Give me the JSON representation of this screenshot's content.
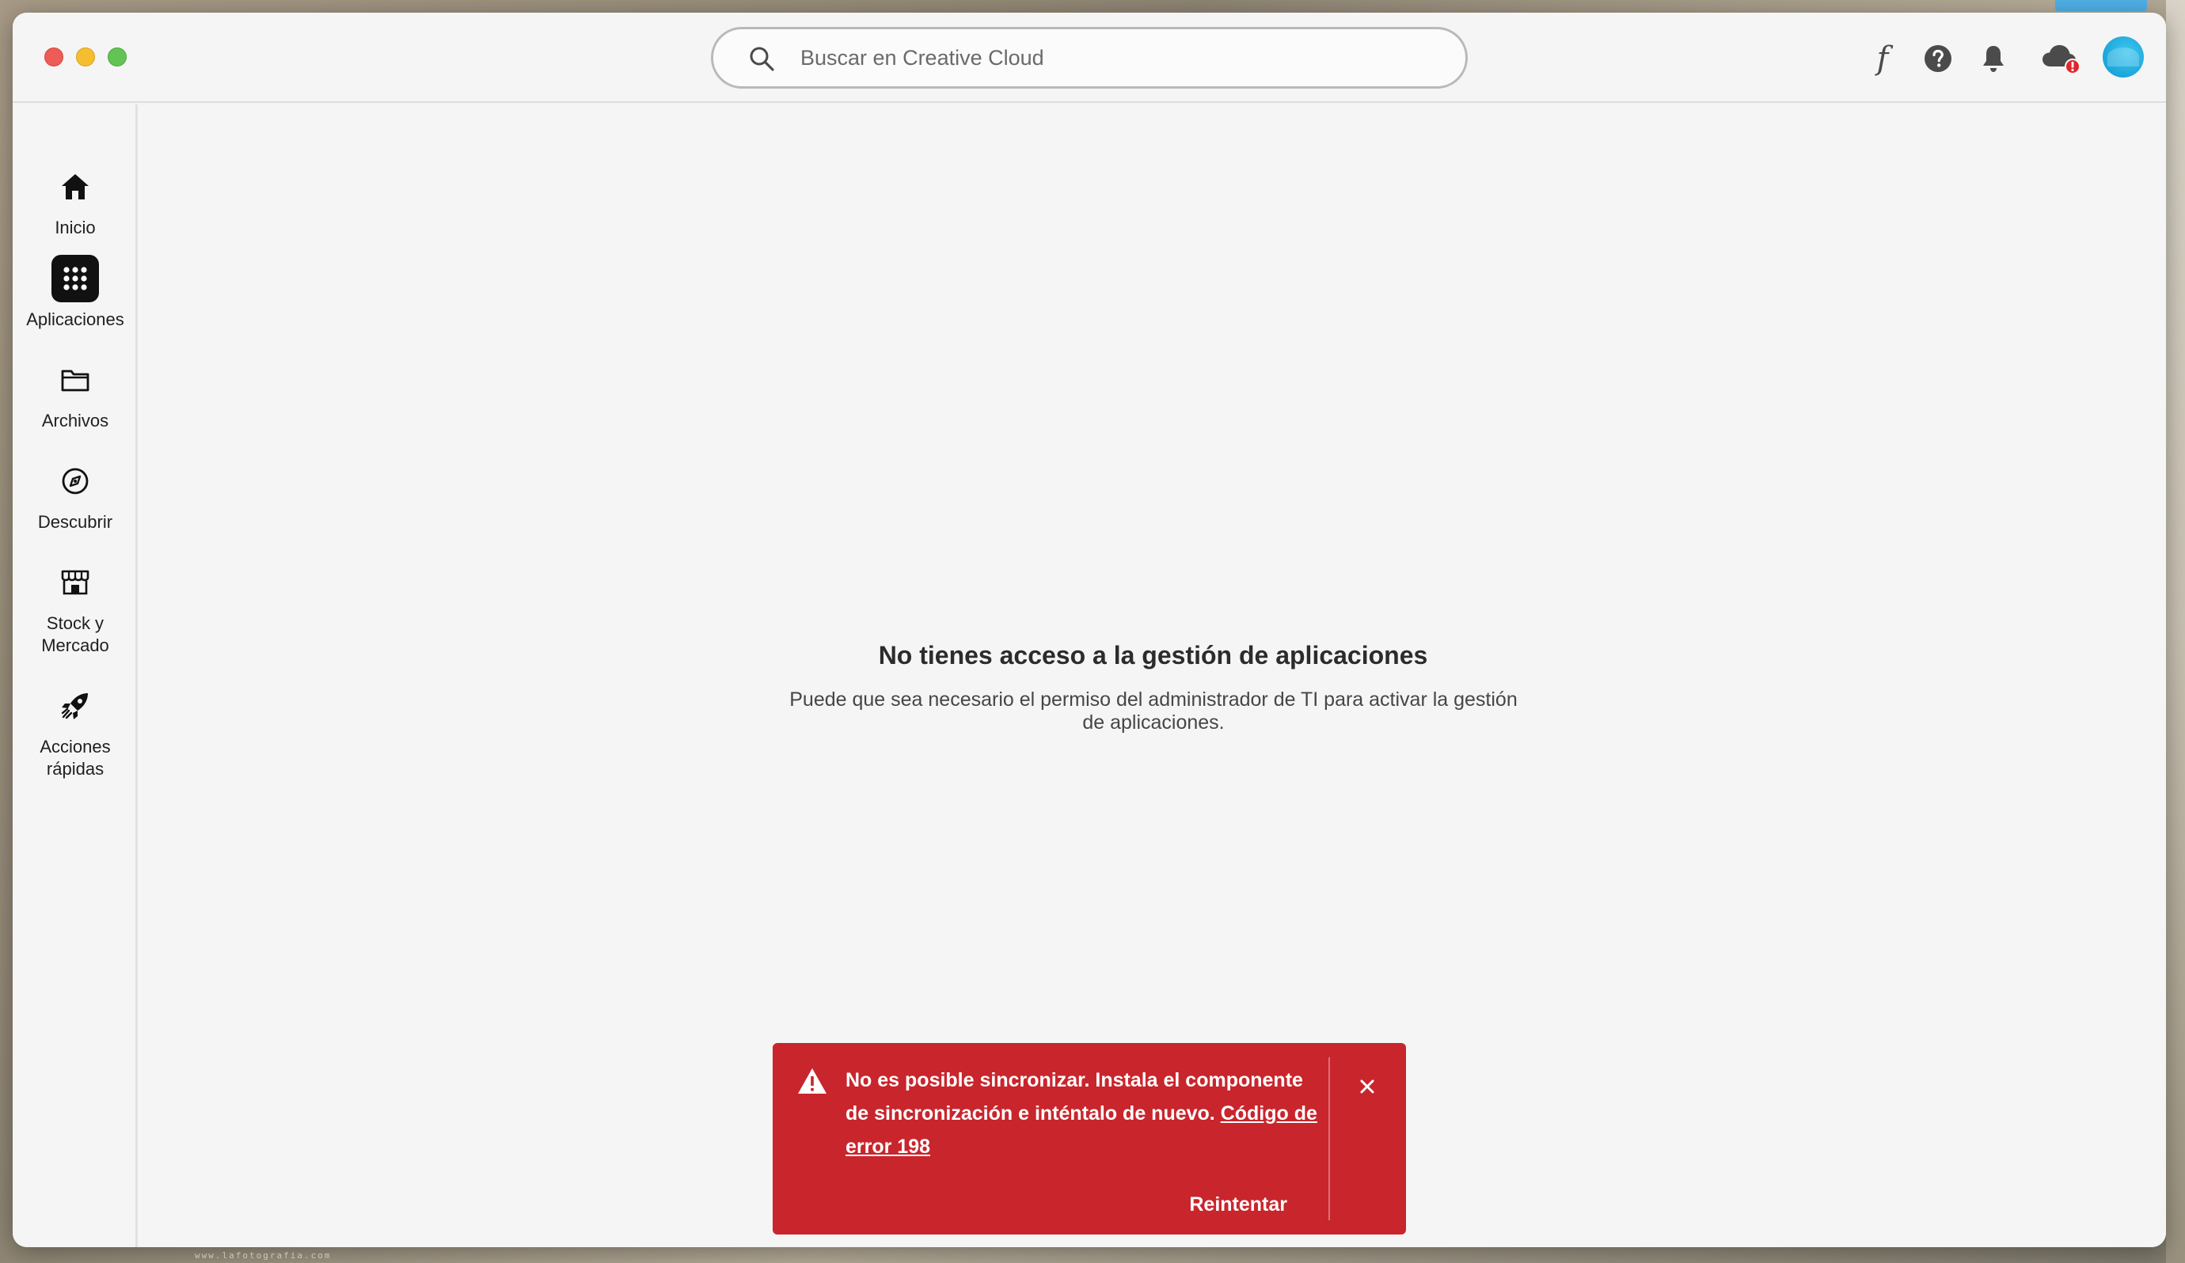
{
  "search": {
    "placeholder": "Buscar en Creative Cloud"
  },
  "header": {
    "fonts_glyph": "f"
  },
  "sidebar": {
    "items": [
      {
        "label": "Inicio",
        "icon": "home-icon"
      },
      {
        "label": "Aplicaciones",
        "icon": "apps-grid-icon",
        "active": true
      },
      {
        "label": "Archivos",
        "icon": "folder-icon"
      },
      {
        "label": "Descubrir",
        "icon": "compass-icon"
      },
      {
        "label": "Stock y Mercado",
        "icon": "stock-market-icon"
      },
      {
        "label": "Acciones rápidas",
        "icon": "rocket-icon"
      }
    ]
  },
  "main": {
    "empty_title": "No tienes acceso a la gestión de aplicaciones",
    "empty_description": "Puede que sea necesario el permiso del administrador de TI para activar la gestión de aplicaciones."
  },
  "toast": {
    "message": "No es posible sincronizar. Instala el componente de sincronización e inténtalo de nuevo.",
    "link": "Código de error 198",
    "retry_label": "Reintentar"
  },
  "colors": {
    "error_toast": "#c9252c",
    "avatar": "#1ba6db",
    "cloud_badge": "#e0262c"
  },
  "watermark": "www.lafotografia.com"
}
